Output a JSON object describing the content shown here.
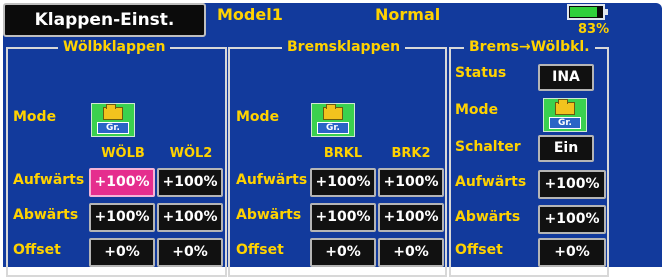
{
  "header": {
    "title": "Klappen-Einst.",
    "model": "Model1",
    "condition": "Normal",
    "battery_percent": "83%",
    "battery_level": 0.83
  },
  "woelb": {
    "title": "Wölbklappen",
    "mode_label": "Mode",
    "mode_value": "Gr.",
    "col1": "WÖLB",
    "col2": "WÖL2",
    "rows": [
      {
        "label": "Aufwärts",
        "v1": "+100%",
        "v2": "+100%"
      },
      {
        "label": "Abwärts",
        "v1": "+100%",
        "v2": "+100%"
      },
      {
        "label": "Offset",
        "v1": "+0%",
        "v2": "+0%"
      }
    ]
  },
  "brems": {
    "title": "Bremsklappen",
    "mode_label": "Mode",
    "mode_value": "Gr.",
    "col1": "BRKL",
    "col2": "BRK2",
    "rows": [
      {
        "label": "Aufwärts",
        "v1": "+100%",
        "v2": "+100%"
      },
      {
        "label": "Abwärts",
        "v1": "+100%",
        "v2": "+100%"
      },
      {
        "label": "Offset",
        "v1": "+0%",
        "v2": "+0%"
      }
    ]
  },
  "mix": {
    "title": "Brems→Wölbkl.",
    "status_label": "Status",
    "status_value": "INA",
    "mode_label": "Mode",
    "mode_value": "Gr.",
    "switch_label": "Schalter",
    "switch_value": "Ein",
    "rows": [
      {
        "label": "Aufwärts",
        "v1": "+100%"
      },
      {
        "label": "Abwärts",
        "v1": "+100%"
      },
      {
        "label": "Offset",
        "v1": "+0%"
      }
    ]
  },
  "colors": {
    "background": "#123a9c",
    "label": "#ffd200",
    "selected": "#e52e8e",
    "mode_button": "#3bd14f"
  }
}
